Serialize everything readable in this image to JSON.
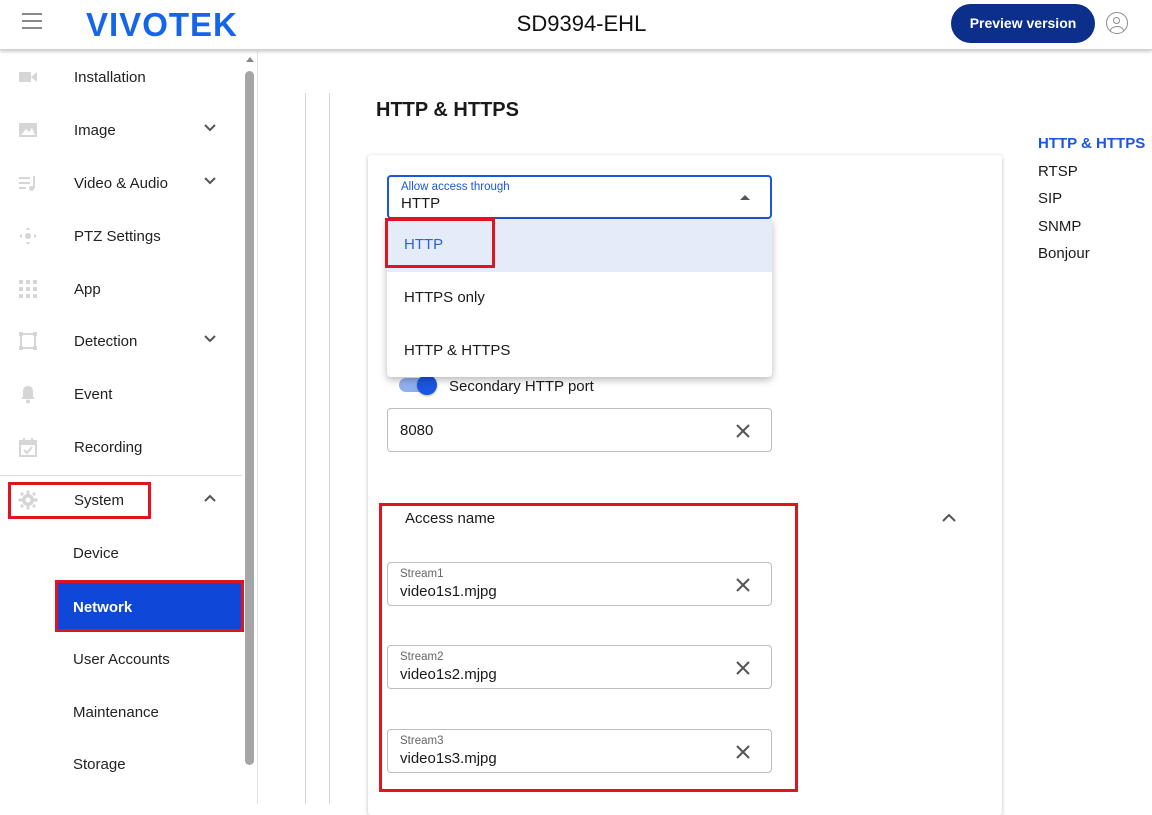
{
  "header": {
    "logo": "VIVOTEK",
    "model": "SD9394-EHL",
    "preview_button": "Preview version"
  },
  "sidebar": {
    "items": [
      {
        "label": "Installation",
        "icon": "video-camera-icon"
      },
      {
        "label": "Image",
        "icon": "image-icon",
        "expandable": true
      },
      {
        "label": "Video & Audio",
        "icon": "playlist-music-icon",
        "expandable": true
      },
      {
        "label": "PTZ Settings",
        "icon": "ptz-control-icon"
      },
      {
        "label": "App",
        "icon": "grid-apps-icon"
      },
      {
        "label": "Detection",
        "icon": "detection-frame-icon",
        "expandable": true
      },
      {
        "label": "Event",
        "icon": "bell-icon"
      },
      {
        "label": "Recording",
        "icon": "calendar-check-icon"
      },
      {
        "label": "System",
        "icon": "gear-icon",
        "expandable": true,
        "expanded": true
      }
    ],
    "system_children": [
      {
        "label": "Device"
      },
      {
        "label": "Network",
        "active": true
      },
      {
        "label": "User Accounts"
      },
      {
        "label": "Maintenance"
      },
      {
        "label": "Storage"
      }
    ]
  },
  "main": {
    "section_title": "HTTP & HTTPS",
    "access_select": {
      "label": "Allow access through",
      "value": "HTTP",
      "options": [
        "HTTP",
        "HTTPS only",
        "HTTP & HTTPS"
      ],
      "selected_index": 0
    },
    "secondary_port": {
      "toggle_label": "Secondary HTTP port",
      "enabled": true,
      "value": "8080"
    },
    "access_name": {
      "title": "Access name",
      "streams": [
        {
          "label": "Stream1",
          "value": "video1s1.mjpg"
        },
        {
          "label": "Stream2",
          "value": "video1s2.mjpg"
        },
        {
          "label": "Stream3",
          "value": "video1s3.mjpg"
        }
      ]
    }
  },
  "toc": {
    "items": [
      "HTTP & HTTPS",
      "RTSP",
      "SIP",
      "SNMP",
      "Bonjour"
    ],
    "active_index": 0
  },
  "colors": {
    "brand": "#1565e8",
    "accent": "#1a56e0",
    "active_nav": "#0f47d8",
    "preview_button": "#0b2f8a",
    "highlight_box": "#e0141e"
  }
}
